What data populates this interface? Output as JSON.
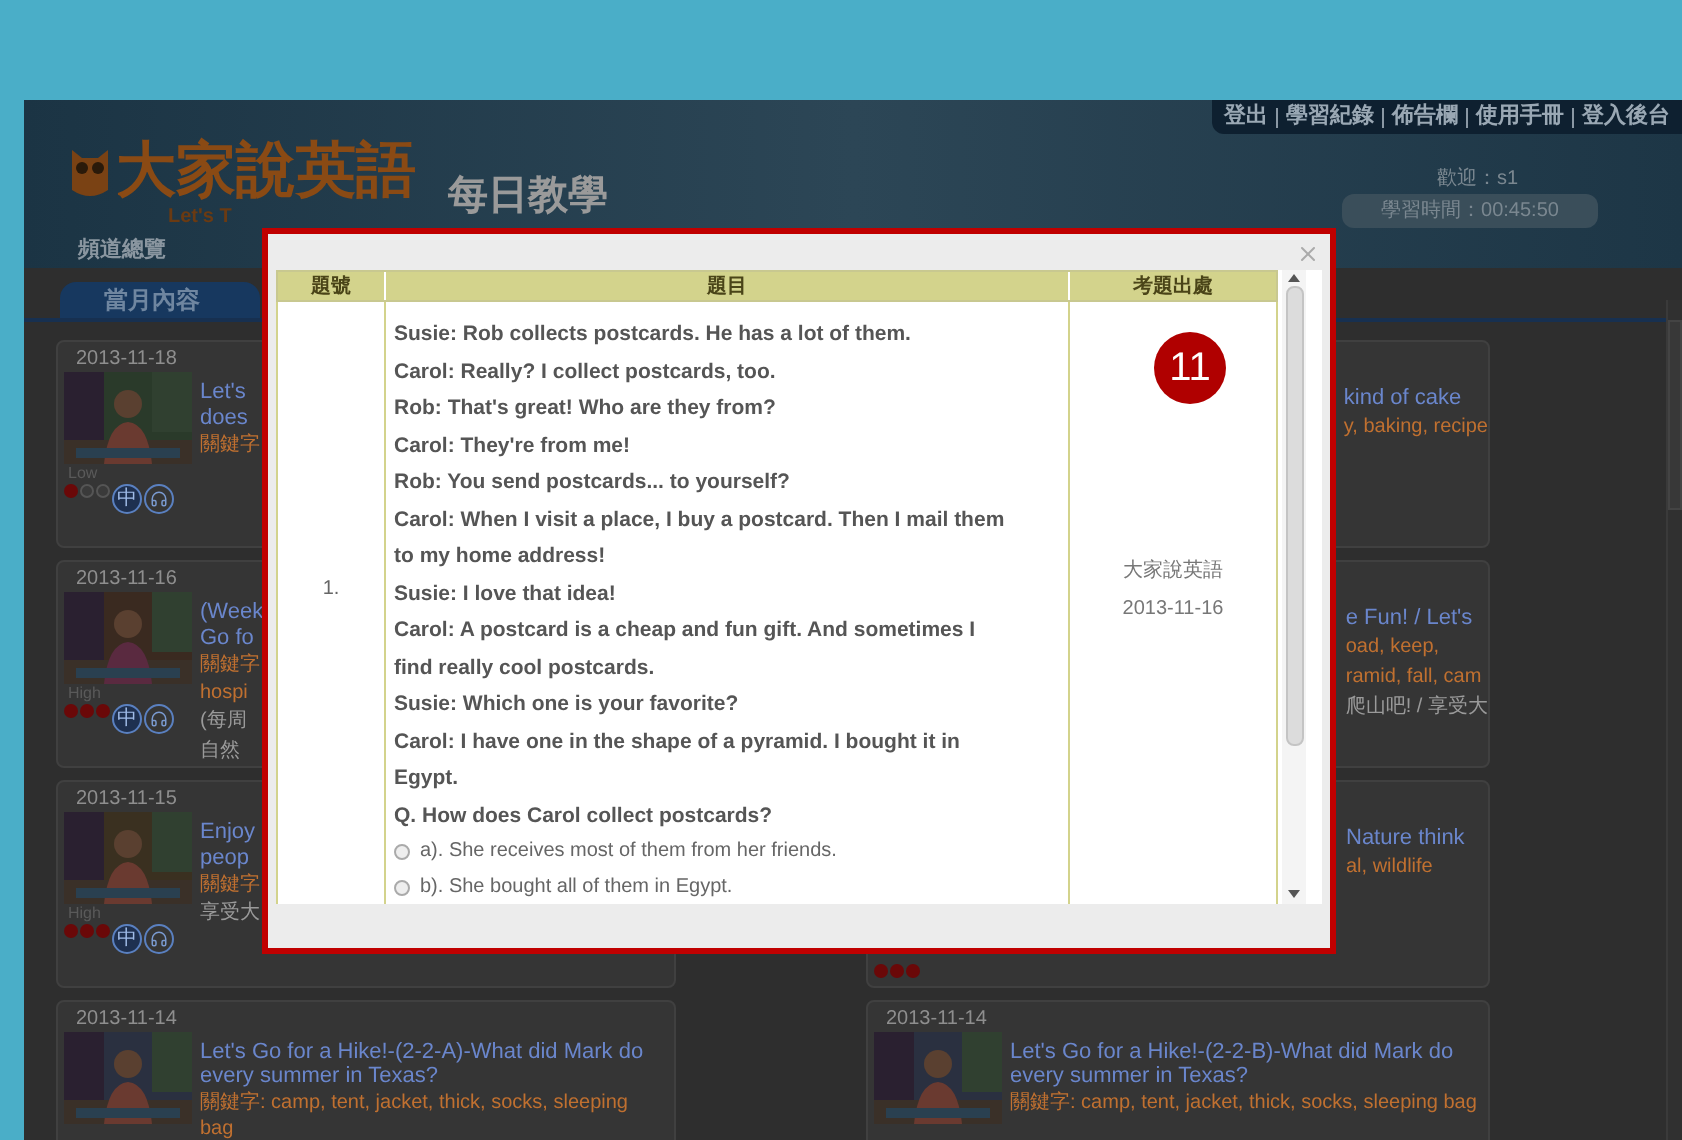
{
  "header": {
    "top_links": [
      "登出",
      "學習紀錄",
      "佈告欄",
      "使用手冊",
      "登入後台"
    ],
    "logo_title": "大家說英語",
    "logo_subtitle": "Let's T",
    "section_title": "每日教學",
    "welcome": "歡迎：s1",
    "study_time": "學習時間：00:45:50",
    "nav": [
      "頻道總覽"
    ]
  },
  "tab": {
    "label": "當月內容",
    "selected": true
  },
  "left_cards": [
    {
      "date": "2013-11-18",
      "lines": [
        {
          "kind": "title",
          "text": "Let's"
        },
        {
          "kind": "title",
          "text": "does"
        },
        {
          "kind": "keyword",
          "text": "關鍵字"
        }
      ],
      "level_label": "Low",
      "stars": 1,
      "lang_badge": "中"
    },
    {
      "date": "2013-11-16",
      "lines": [
        {
          "kind": "title",
          "text": "(Week"
        },
        {
          "kind": "title",
          "text": "Go fo"
        },
        {
          "kind": "keyword",
          "text": "關鍵字"
        },
        {
          "kind": "keyword",
          "text": "hospi"
        },
        {
          "kind": "desc",
          "text": "(每周"
        },
        {
          "kind": "desc",
          "text": "自然"
        }
      ],
      "level_label": "High",
      "stars": 3,
      "lang_badge": "中"
    },
    {
      "date": "2013-11-15",
      "lines": [
        {
          "kind": "title",
          "text": "Enjoy"
        },
        {
          "kind": "title",
          "text": "peop"
        },
        {
          "kind": "keyword",
          "text": "關鍵字"
        },
        {
          "kind": "desc",
          "text": "享受大"
        }
      ],
      "level_label": "High",
      "stars": 3,
      "lang_badge": "中"
    },
    {
      "date": "2013-11-14",
      "lines": [
        {
          "kind": "title",
          "text": "Let's Go for a Hike!-(2-2-A)-What did Mark do every summer in Texas?"
        },
        {
          "kind": "keyword",
          "text": "關鍵字: camp, tent, jacket, thick, socks, sleeping bag"
        }
      ]
    }
  ],
  "right_cards": [
    {
      "lines": [
        {
          "kind": "title",
          "text": "kind of cake"
        },
        {
          "kind": "keyword",
          "text": "y, baking, recipe"
        }
      ]
    },
    {
      "lines": [
        {
          "kind": "title",
          "text": "e Fun! / Let's"
        },
        {
          "kind": "keyword",
          "text": "oad, keep,"
        },
        {
          "kind": "keyword",
          "text": "ramid, fall, cam"
        },
        {
          "kind": "desc",
          "text": "爬山吧! / 享受大"
        }
      ]
    },
    {
      "lines": [
        {
          "kind": "title",
          "text": "Nature think"
        },
        {
          "kind": "keyword",
          "text": "al, wildlife"
        }
      ],
      "stars": 3
    },
    {
      "date": "2013-11-14",
      "lines": [
        {
          "kind": "title",
          "text": "Let's Go for a Hike!-(2-2-B)-What did Mark do every summer in Texas?"
        },
        {
          "kind": "keyword",
          "text": "關鍵字: camp, tent, jacket, thick, socks, sleeping bag"
        }
      ]
    }
  ],
  "modal": {
    "columns": [
      "題號",
      "題目",
      "考題出處"
    ],
    "rows": [
      {
        "number": "1.",
        "dialogue": [
          "Susie: Rob collects postcards. He has a lot of them.",
          "Carol: Really? I collect postcards, too.",
          "Rob: That's great! Who are they from?",
          "Carol: They're from me!",
          "Rob: You send postcards... to yourself?",
          "Carol: When I visit a place, I buy a postcard. Then I mail them to my home address!",
          "Susie: I love that idea!",
          "Carol: A postcard is a cheap and fun gift. And sometimes I find really cool postcards.",
          "Susie: Which one is your favorite?",
          "Carol: I have one in the shape of a pyramid. I bought it in Egypt."
        ],
        "question": "Q. How does Carol collect postcards?",
        "options": [
          {
            "text": "a). She receives most of them from her friends.",
            "selected": false
          },
          {
            "text": "b). She bought all of them in Egypt.",
            "selected": false
          }
        ],
        "source": [
          "大家說英語",
          "2013-11-16"
        ]
      }
    ]
  },
  "badge": "11"
}
